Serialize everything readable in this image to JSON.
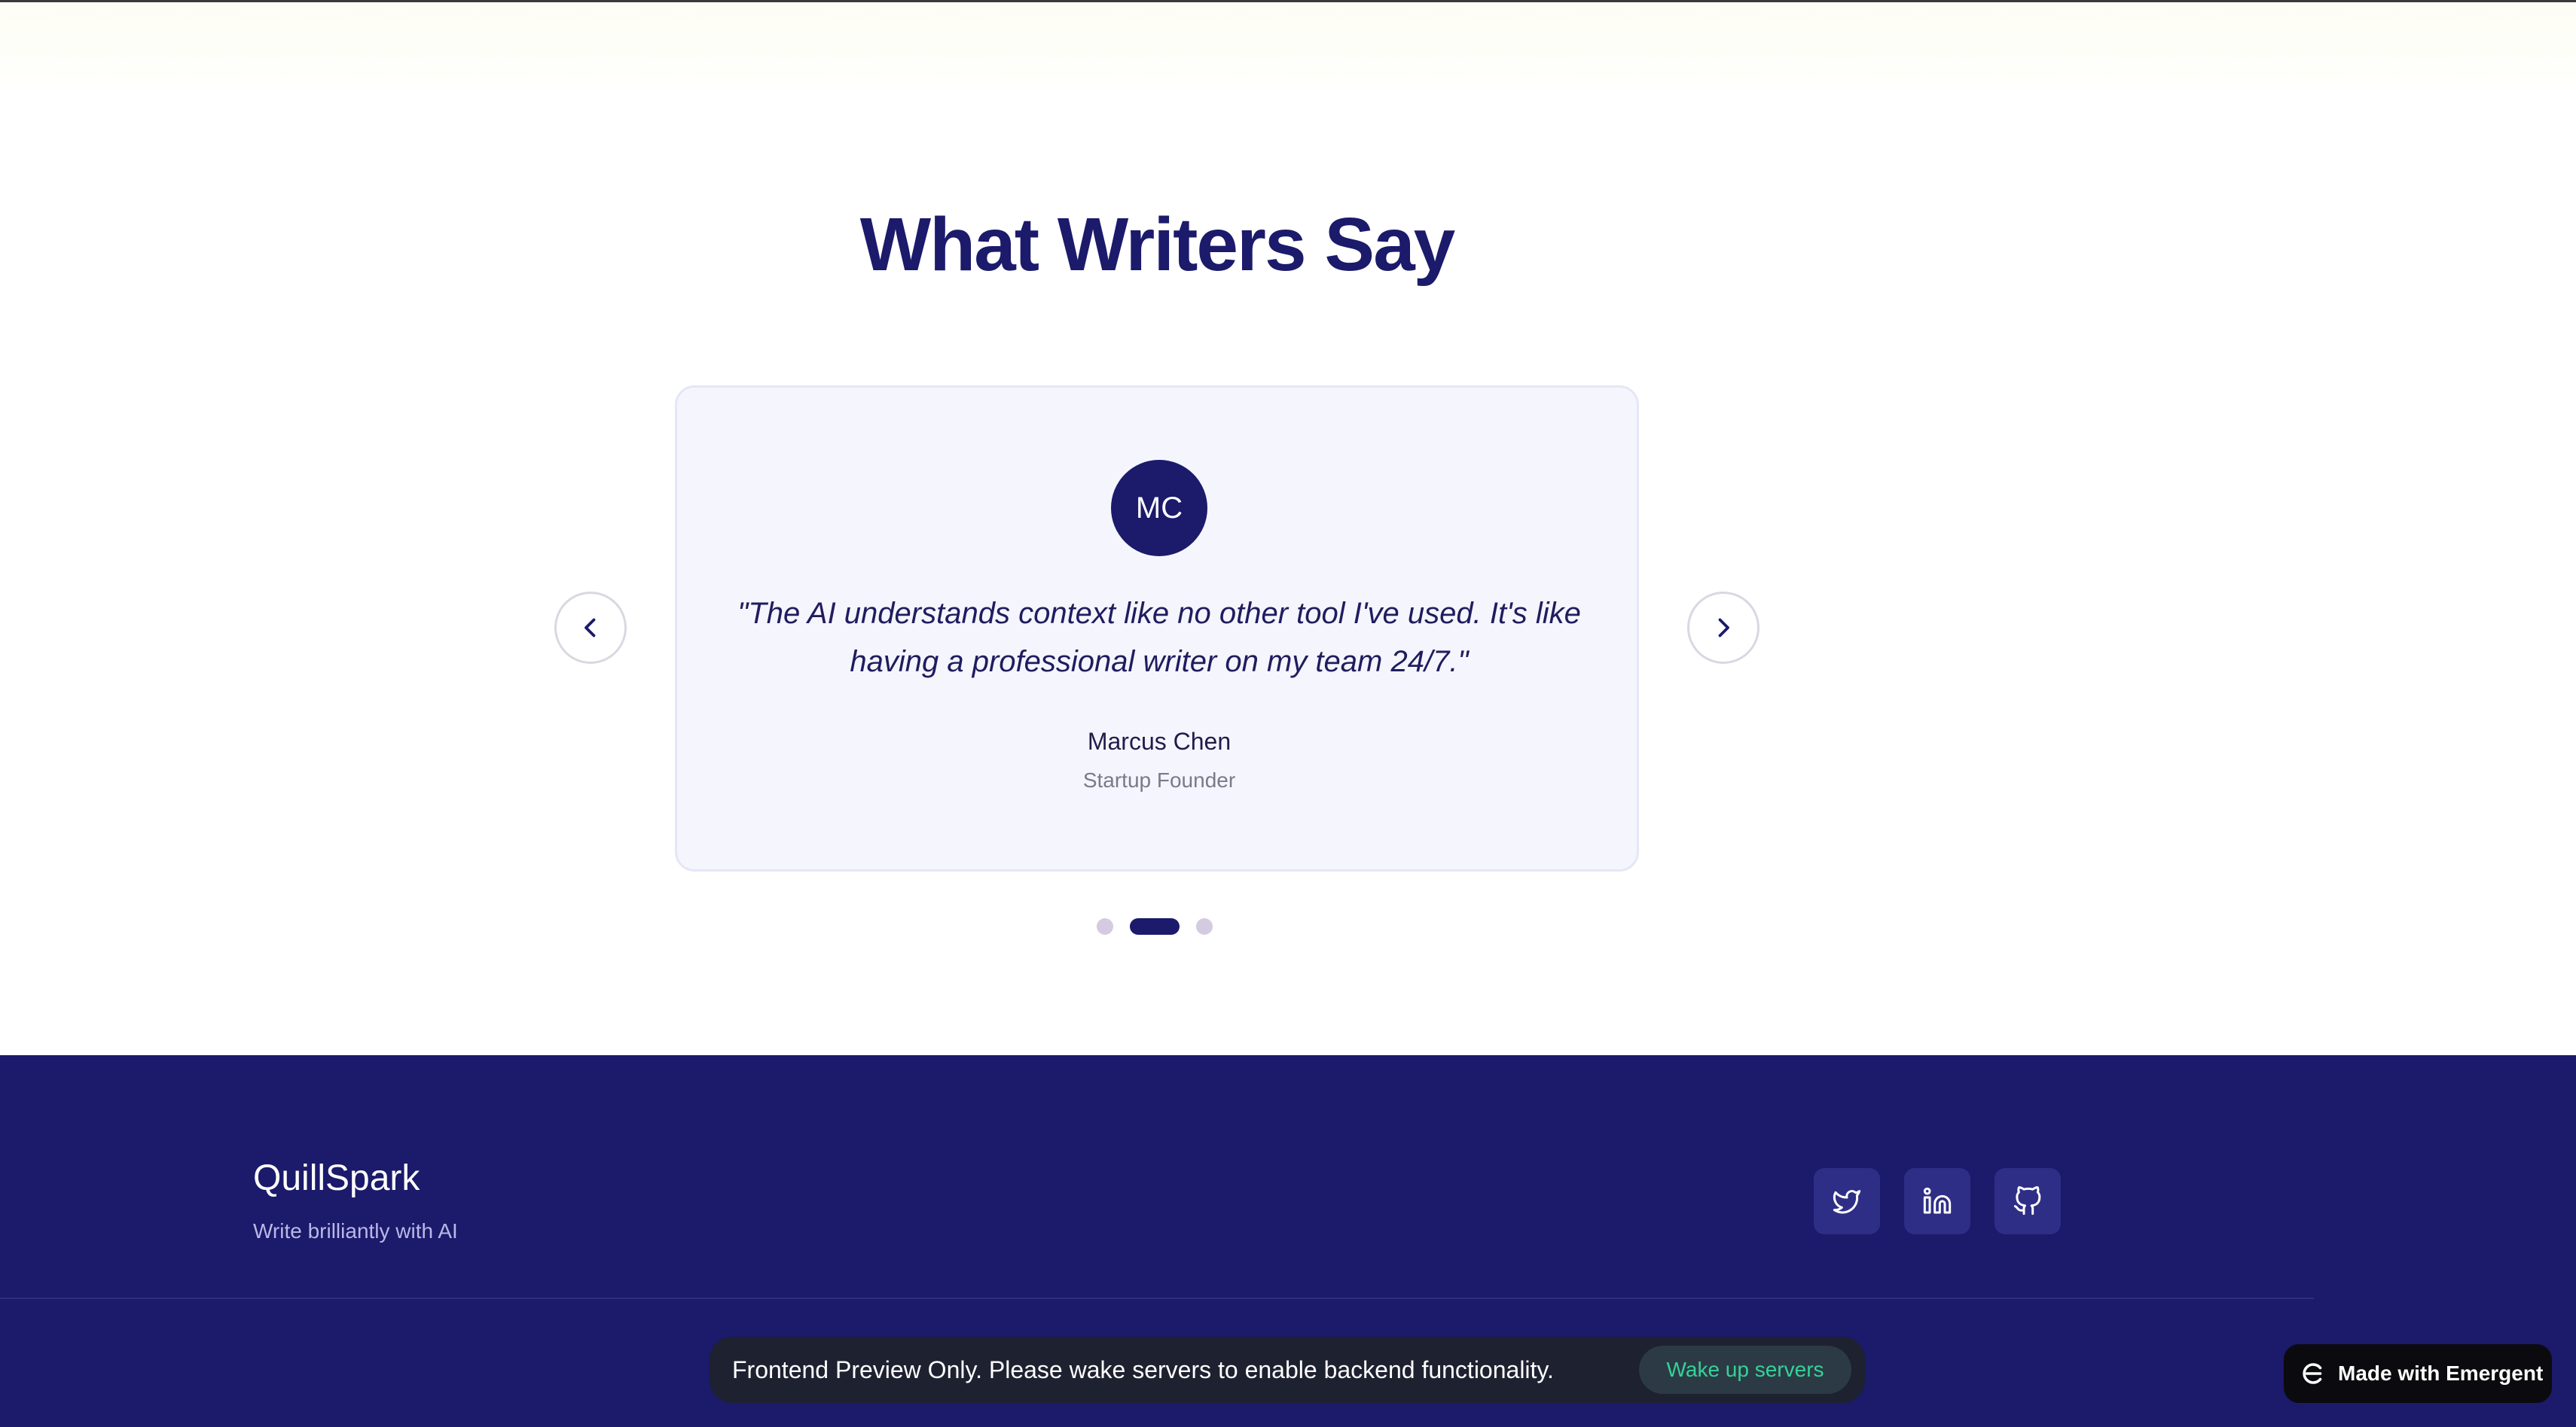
{
  "testimonials": {
    "title": "What Writers Say",
    "current": {
      "initials": "MC",
      "quote": "\"The AI understands context like no other tool I've used. It's like having a professional writer on my team 24/7.\"",
      "name": "Marcus Chen",
      "role": "Startup Founder"
    },
    "active_index": 1,
    "total": 3
  },
  "footer": {
    "brand": "QuillSpark",
    "tagline": "Write brilliantly with AI",
    "social_icons": [
      "twitter-icon",
      "linkedin-icon",
      "github-icon"
    ]
  },
  "preview_banner": {
    "message": "Frontend Preview Only. Please wake servers to enable backend functionality.",
    "button_label": "Wake up servers"
  },
  "made_with": {
    "label": "Made with Emergent"
  },
  "colors": {
    "primary": "#1b1a6b",
    "card_bg": "#f5f5fe",
    "accent_green": "#34d399"
  }
}
